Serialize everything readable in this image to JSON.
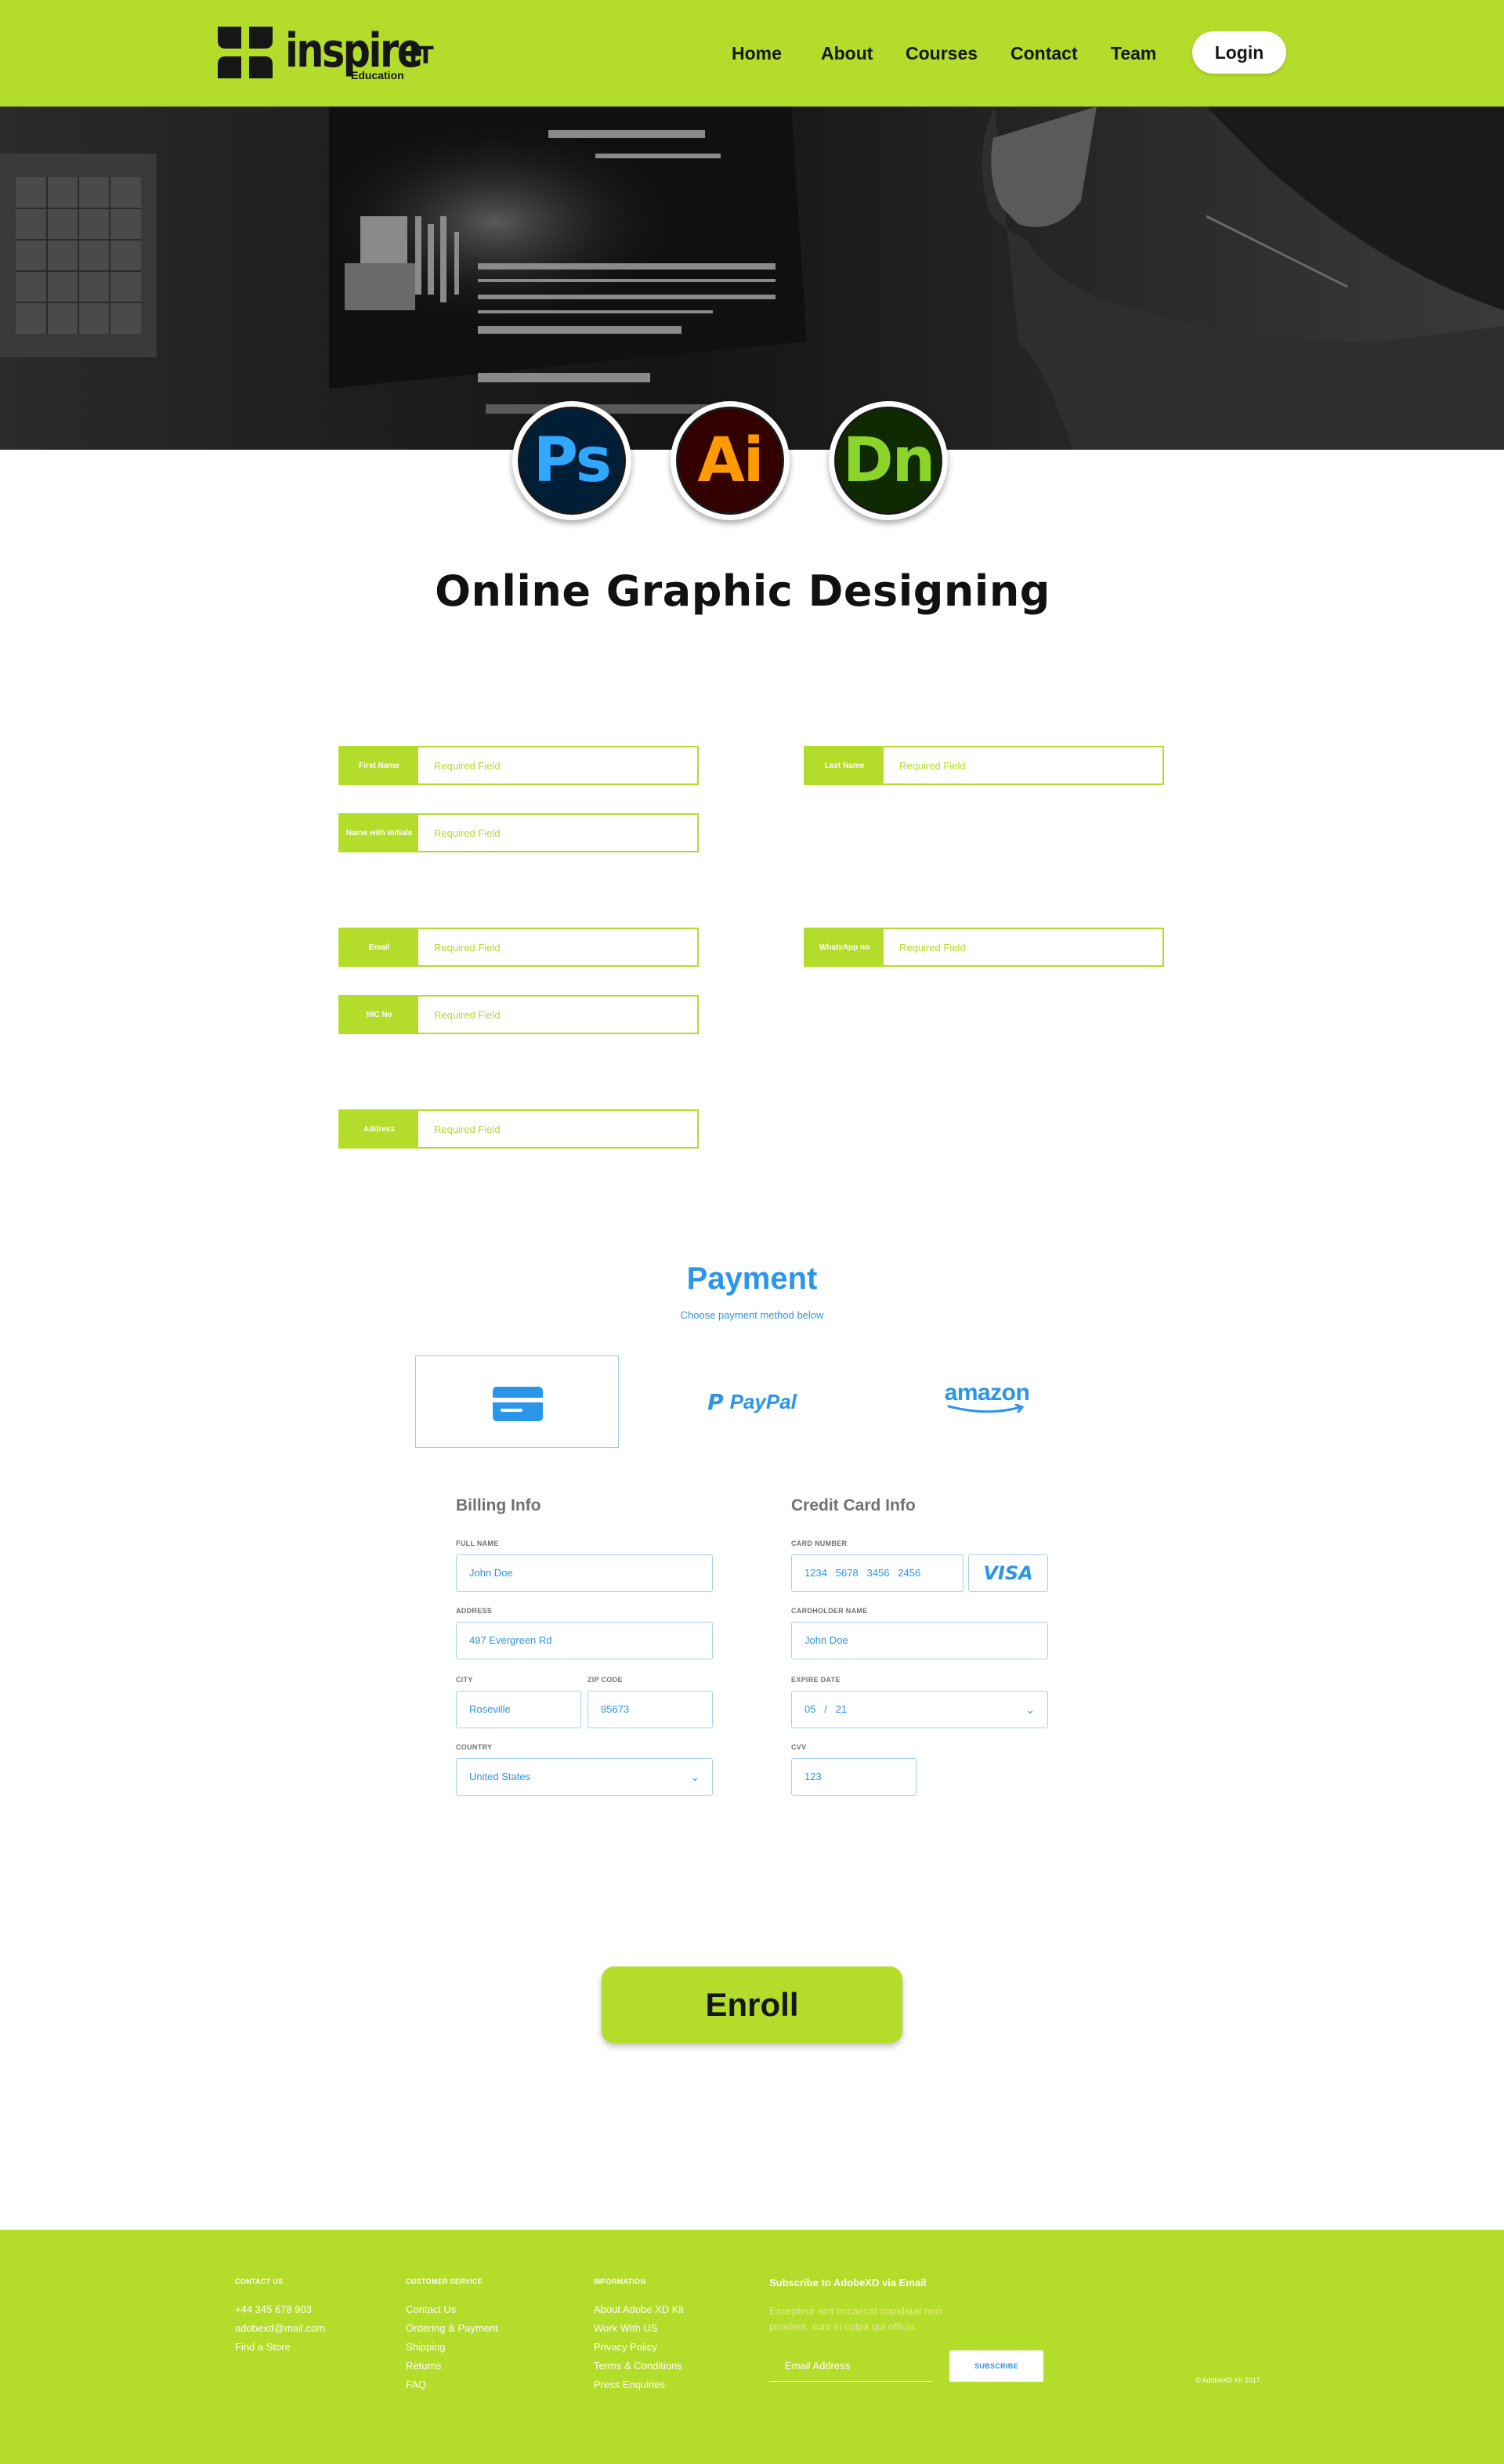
{
  "header": {
    "logo_text": "inspire",
    "logo_suffix": "IT",
    "logo_sub": "Education",
    "nav": [
      "Home",
      "About",
      "Courses",
      "Contact",
      "Team"
    ],
    "login_label": "Login",
    "accent_color": "#b4dc2a"
  },
  "hero": {
    "apps": [
      {
        "label": "Ps",
        "icon": "photoshop-icon",
        "bg": "#001e36",
        "fg": "#31a8ff"
      },
      {
        "label": "Ai",
        "icon": "illustrator-icon",
        "bg": "#330000",
        "fg": "#ff9a00"
      },
      {
        "label": "Dn",
        "icon": "dimension-icon",
        "bg": "#0f2a00",
        "fg": "#8bd42a"
      }
    ],
    "title": "Online Graphic Designing"
  },
  "form": {
    "placeholder": "Required Field",
    "fields": [
      {
        "label": "First Name"
      },
      {
        "label": "Last Name"
      },
      {
        "label": "Name with initials"
      },
      {
        "label": "Email"
      },
      {
        "label": "WhatsApp no"
      },
      {
        "label": "NIC No"
      },
      {
        "label": "Address"
      }
    ]
  },
  "payment": {
    "title": "Payment",
    "subtitle": "Choose payment method below",
    "methods": [
      {
        "name": "card",
        "icon": "credit-card-icon"
      },
      {
        "name": "PayPal",
        "icon": "paypal-icon"
      },
      {
        "name": "amazon",
        "icon": "amazon-icon"
      }
    ],
    "billing": {
      "heading": "Billing Info",
      "full_name_label": "FULL NAME",
      "full_name": "John Doe",
      "address_label": "ADDRESS",
      "address": "497 Evergreen Rd",
      "city_label": "CITY",
      "city": "Roseville",
      "zip_label": "ZIP CODE",
      "zip": "95673",
      "country_label": "COUNTRY",
      "country": "United States"
    },
    "card": {
      "heading": "Credit Card Info",
      "number_label": "CARD NUMBER",
      "number": "1234   5678   3456   2456",
      "brand": "VISA",
      "holder_label": "CARDHOLDER NAME",
      "holder": "John Doe",
      "expire_label": "EXPIRE DATE",
      "expire": "05   /   21",
      "cvv_label": "CVV",
      "cvv": "123"
    },
    "link_color": "#2b95ea"
  },
  "enroll_label": "Enroll",
  "footer": {
    "contact": {
      "heading": "CONTACT US",
      "items": [
        "+44 345 678 903",
        "adobexd@mail.com",
        "Find a Store"
      ]
    },
    "service": {
      "heading": "CUSTOMER SERVICE",
      "items": [
        "Contact Us",
        "Ordering & Payment",
        "Shipping",
        "Returns",
        "FAQ"
      ]
    },
    "info": {
      "heading": "INFORMATION",
      "items": [
        "About Adobe XD Kit",
        "Work With US",
        "Privacy Policy",
        "Terms & Conditions",
        "Press Enquiries"
      ]
    },
    "subscribe": {
      "heading": "Subscribe to AdobeXD via Email",
      "desc": "Excepteur sint occaecat cupidatat non proident, sunt in culpa qui officia.",
      "email_placeholder": "Email Address",
      "button": "SUBSCRIBE"
    },
    "copyright": "© AdobeXD Kit 2017"
  }
}
